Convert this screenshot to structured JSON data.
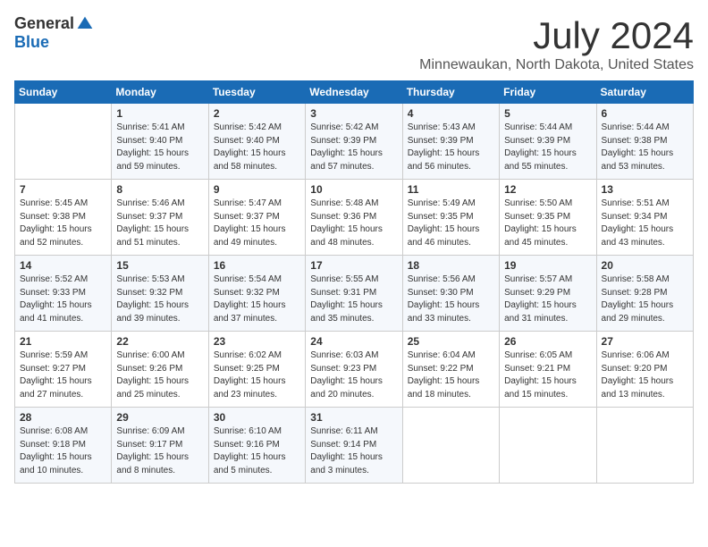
{
  "header": {
    "logo_general": "General",
    "logo_blue": "Blue",
    "month": "July 2024",
    "location": "Minnewaukan, North Dakota, United States"
  },
  "days_of_week": [
    "Sunday",
    "Monday",
    "Tuesday",
    "Wednesday",
    "Thursday",
    "Friday",
    "Saturday"
  ],
  "weeks": [
    [
      {
        "day": "",
        "info": ""
      },
      {
        "day": "1",
        "info": "Sunrise: 5:41 AM\nSunset: 9:40 PM\nDaylight: 15 hours\nand 59 minutes."
      },
      {
        "day": "2",
        "info": "Sunrise: 5:42 AM\nSunset: 9:40 PM\nDaylight: 15 hours\nand 58 minutes."
      },
      {
        "day": "3",
        "info": "Sunrise: 5:42 AM\nSunset: 9:39 PM\nDaylight: 15 hours\nand 57 minutes."
      },
      {
        "day": "4",
        "info": "Sunrise: 5:43 AM\nSunset: 9:39 PM\nDaylight: 15 hours\nand 56 minutes."
      },
      {
        "day": "5",
        "info": "Sunrise: 5:44 AM\nSunset: 9:39 PM\nDaylight: 15 hours\nand 55 minutes."
      },
      {
        "day": "6",
        "info": "Sunrise: 5:44 AM\nSunset: 9:38 PM\nDaylight: 15 hours\nand 53 minutes."
      }
    ],
    [
      {
        "day": "7",
        "info": "Sunrise: 5:45 AM\nSunset: 9:38 PM\nDaylight: 15 hours\nand 52 minutes."
      },
      {
        "day": "8",
        "info": "Sunrise: 5:46 AM\nSunset: 9:37 PM\nDaylight: 15 hours\nand 51 minutes."
      },
      {
        "day": "9",
        "info": "Sunrise: 5:47 AM\nSunset: 9:37 PM\nDaylight: 15 hours\nand 49 minutes."
      },
      {
        "day": "10",
        "info": "Sunrise: 5:48 AM\nSunset: 9:36 PM\nDaylight: 15 hours\nand 48 minutes."
      },
      {
        "day": "11",
        "info": "Sunrise: 5:49 AM\nSunset: 9:35 PM\nDaylight: 15 hours\nand 46 minutes."
      },
      {
        "day": "12",
        "info": "Sunrise: 5:50 AM\nSunset: 9:35 PM\nDaylight: 15 hours\nand 45 minutes."
      },
      {
        "day": "13",
        "info": "Sunrise: 5:51 AM\nSunset: 9:34 PM\nDaylight: 15 hours\nand 43 minutes."
      }
    ],
    [
      {
        "day": "14",
        "info": "Sunrise: 5:52 AM\nSunset: 9:33 PM\nDaylight: 15 hours\nand 41 minutes."
      },
      {
        "day": "15",
        "info": "Sunrise: 5:53 AM\nSunset: 9:32 PM\nDaylight: 15 hours\nand 39 minutes."
      },
      {
        "day": "16",
        "info": "Sunrise: 5:54 AM\nSunset: 9:32 PM\nDaylight: 15 hours\nand 37 minutes."
      },
      {
        "day": "17",
        "info": "Sunrise: 5:55 AM\nSunset: 9:31 PM\nDaylight: 15 hours\nand 35 minutes."
      },
      {
        "day": "18",
        "info": "Sunrise: 5:56 AM\nSunset: 9:30 PM\nDaylight: 15 hours\nand 33 minutes."
      },
      {
        "day": "19",
        "info": "Sunrise: 5:57 AM\nSunset: 9:29 PM\nDaylight: 15 hours\nand 31 minutes."
      },
      {
        "day": "20",
        "info": "Sunrise: 5:58 AM\nSunset: 9:28 PM\nDaylight: 15 hours\nand 29 minutes."
      }
    ],
    [
      {
        "day": "21",
        "info": "Sunrise: 5:59 AM\nSunset: 9:27 PM\nDaylight: 15 hours\nand 27 minutes."
      },
      {
        "day": "22",
        "info": "Sunrise: 6:00 AM\nSunset: 9:26 PM\nDaylight: 15 hours\nand 25 minutes."
      },
      {
        "day": "23",
        "info": "Sunrise: 6:02 AM\nSunset: 9:25 PM\nDaylight: 15 hours\nand 23 minutes."
      },
      {
        "day": "24",
        "info": "Sunrise: 6:03 AM\nSunset: 9:23 PM\nDaylight: 15 hours\nand 20 minutes."
      },
      {
        "day": "25",
        "info": "Sunrise: 6:04 AM\nSunset: 9:22 PM\nDaylight: 15 hours\nand 18 minutes."
      },
      {
        "day": "26",
        "info": "Sunrise: 6:05 AM\nSunset: 9:21 PM\nDaylight: 15 hours\nand 15 minutes."
      },
      {
        "day": "27",
        "info": "Sunrise: 6:06 AM\nSunset: 9:20 PM\nDaylight: 15 hours\nand 13 minutes."
      }
    ],
    [
      {
        "day": "28",
        "info": "Sunrise: 6:08 AM\nSunset: 9:18 PM\nDaylight: 15 hours\nand 10 minutes."
      },
      {
        "day": "29",
        "info": "Sunrise: 6:09 AM\nSunset: 9:17 PM\nDaylight: 15 hours\nand 8 minutes."
      },
      {
        "day": "30",
        "info": "Sunrise: 6:10 AM\nSunset: 9:16 PM\nDaylight: 15 hours\nand 5 minutes."
      },
      {
        "day": "31",
        "info": "Sunrise: 6:11 AM\nSunset: 9:14 PM\nDaylight: 15 hours\nand 3 minutes."
      },
      {
        "day": "",
        "info": ""
      },
      {
        "day": "",
        "info": ""
      },
      {
        "day": "",
        "info": ""
      }
    ]
  ]
}
